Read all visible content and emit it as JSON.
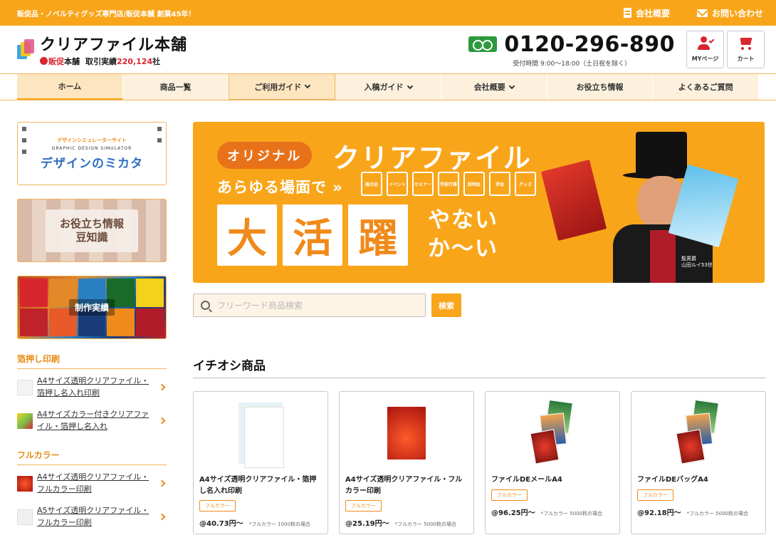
{
  "topbar": {
    "tagline": "販促品・ノベルティグッズ専門店/販促本舗 創業45年！",
    "links": [
      {
        "label": "会社概要",
        "icon": "building-icon"
      },
      {
        "label": "お問い合わせ",
        "icon": "mail-icon"
      }
    ]
  },
  "header": {
    "site_name": "クリアファイル本舗",
    "brand_mark": "販促",
    "brand_name": "本舗",
    "record_label": "取引実績",
    "record_count": "220,124",
    "record_unit": "社",
    "phone": "0120-296-890",
    "hours": "受付時間 9:00〜18:00（土日祝を除く）",
    "buttons": [
      {
        "label": "MYページ",
        "icon": "user-check-icon"
      },
      {
        "label": "カート",
        "icon": "cart-icon"
      }
    ]
  },
  "nav": {
    "items": [
      {
        "label": "ホーム",
        "dropdown": false
      },
      {
        "label": "商品一覧",
        "dropdown": false
      },
      {
        "label": "ご利用ガイド",
        "dropdown": true
      },
      {
        "label": "入稿ガイド",
        "dropdown": true
      },
      {
        "label": "会社概要",
        "dropdown": true
      },
      {
        "label": "お役立ち情報",
        "dropdown": false
      },
      {
        "label": "よくあるご質問",
        "dropdown": false
      }
    ]
  },
  "sidebar": {
    "banners": {
      "simulator": {
        "line1": "デザインシミュレーターサイト",
        "line2": "GRAPHIC DESIGN SIMULATOR",
        "line3": "デザインのミカタ"
      },
      "mame": {
        "line1": "お役立ち情報",
        "line2": "豆知識"
      },
      "jisseki": {
        "label": "制作実績"
      }
    },
    "sections": [
      {
        "title": "箔押し印刷",
        "items": [
          {
            "label": "A4サイズ透明クリアファイル・箔押し名入れ印刷",
            "thumb": "#f3f3f3"
          },
          {
            "label": "A4サイズカラー付きクリアファイル・箔押し名入れ",
            "thumb": "#7ac24a"
          }
        ]
      },
      {
        "title": "フルカラー",
        "items": [
          {
            "label": "A4サイズ透明クリアファイル・フルカラー印刷",
            "thumb": "#c8161d"
          },
          {
            "label": "A5サイズ透明クリアファイル・フルカラー印刷",
            "thumb": "#f0f0f0"
          }
        ]
      }
    ]
  },
  "hero": {
    "tag": "オリジナル",
    "headline": "クリアファイル",
    "subline": "あらゆる場面で »",
    "chips": [
      "展示会",
      "イベント",
      "セミナー",
      "学校行事",
      "説明会",
      "学会",
      "グッズ"
    ],
    "big_chars": [
      "大",
      "活",
      "躍"
    ],
    "tail_line1": "やない",
    "tail_line2": "か〜い",
    "caption_line1": "髭男爵",
    "caption_line2": "山田ルイ53世"
  },
  "search": {
    "placeholder": "フリーワード商品検索",
    "button": "検索"
  },
  "featured": {
    "title": "イチオシ商品",
    "products": [
      {
        "name": "A4サイズ透明クリアファイル・箔押し名入れ印刷",
        "badge": "フルカラー",
        "price": "@40.73円〜",
        "note": "*フルカラー 1000枚の場合",
        "image": "clear"
      },
      {
        "name": "A4サイズ透明クリアファイル・フルカラー印刷",
        "badge": "フルカラー",
        "price": "@25.19円〜",
        "note": "*フルカラー 5000枚の場合",
        "image": "red"
      },
      {
        "name": "ファイルDEメールA4",
        "badge": "フルカラー",
        "price": "@96.25円〜",
        "note": "*フルカラー 5000枚の場合",
        "image": "stack"
      },
      {
        "name": "ファイルDEバッグA4",
        "badge": "フルカラー",
        "price": "@92.18円〜",
        "note": "*フルカラー 5000枚の場合",
        "image": "stack"
      }
    ]
  },
  "colors": {
    "accent": "#f9a51a",
    "accent_dark": "#f08a1a",
    "brand_red": "#d8262f",
    "freedial_green": "#2c9a3c"
  }
}
